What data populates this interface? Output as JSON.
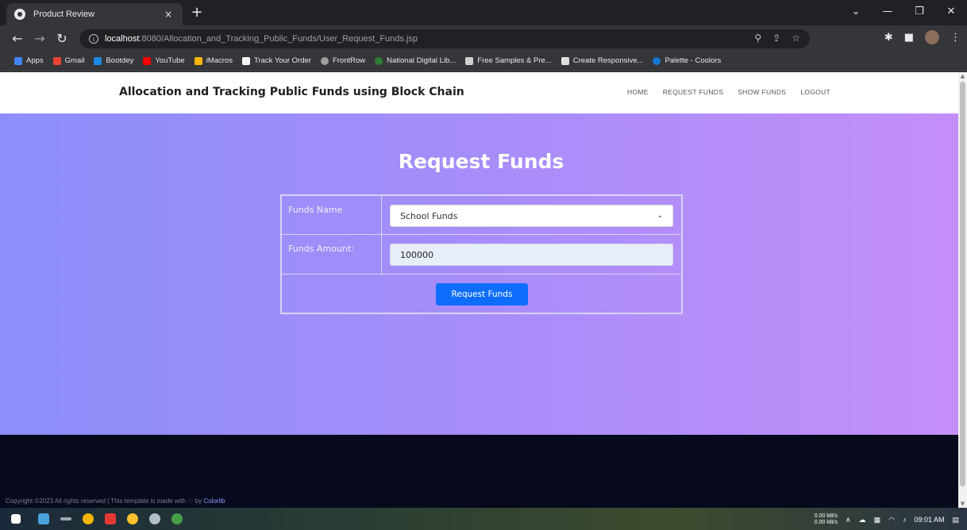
{
  "browser": {
    "tab_title": "Product Review",
    "tab_close": "×",
    "new_tab": "+",
    "url_host": "localhost",
    "url_path": ":8080/Allocation_and_Tracking_Public_Funds/User_Request_Funds.jsp",
    "window_controls": {
      "minimize": "—",
      "maximize": "❐",
      "close": "✕"
    },
    "bookmarks": [
      {
        "label": "Apps",
        "color": "#4285f4"
      },
      {
        "label": "Gmail",
        "color": "#ea4335"
      },
      {
        "label": "Bootdey",
        "color": "#1e88e5"
      },
      {
        "label": "YouTube",
        "color": "#ff0000"
      },
      {
        "label": "iMacros",
        "color": "#f4b400"
      },
      {
        "label": "Track Your Order",
        "color": "#111111"
      },
      {
        "label": "FrontRow",
        "color": "#777777"
      },
      {
        "label": "National Digital Lib...",
        "color": "#2e7d32"
      },
      {
        "label": "Free Samples & Pre...",
        "color": "#cfcfcf"
      },
      {
        "label": "Create Responsive...",
        "color": "#1a1a1a"
      },
      {
        "label": "Palette - Coolors",
        "color": "#1976d2"
      }
    ]
  },
  "site": {
    "brand": "Allocation and Tracking Public Funds using Block Chain",
    "nav": [
      "HOME",
      "REQUEST FUNDS",
      "SHOW FUNDS",
      "LOGOUT"
    ]
  },
  "form": {
    "title": "Request Funds",
    "funds_name_label": "Funds Name",
    "funds_name_value": "School Funds",
    "funds_amount_label": "Funds Amount:",
    "funds_amount_value": "100000",
    "submit_label": "Request Funds"
  },
  "footer": {
    "copyright_prefix": "Copyright ©2023 All rights reserved | This template is made with ♡ by ",
    "credit": "Colorlib"
  },
  "taskbar": {
    "net_down": "0.00 kB/s",
    "net_up": "0.00 kB/s",
    "clock": "09:01 AM"
  },
  "colors": {
    "hero_start": "#8c8ffb",
    "hero_end": "#c48ef9",
    "button": "#0d6efd",
    "footer": "#060a1c"
  }
}
